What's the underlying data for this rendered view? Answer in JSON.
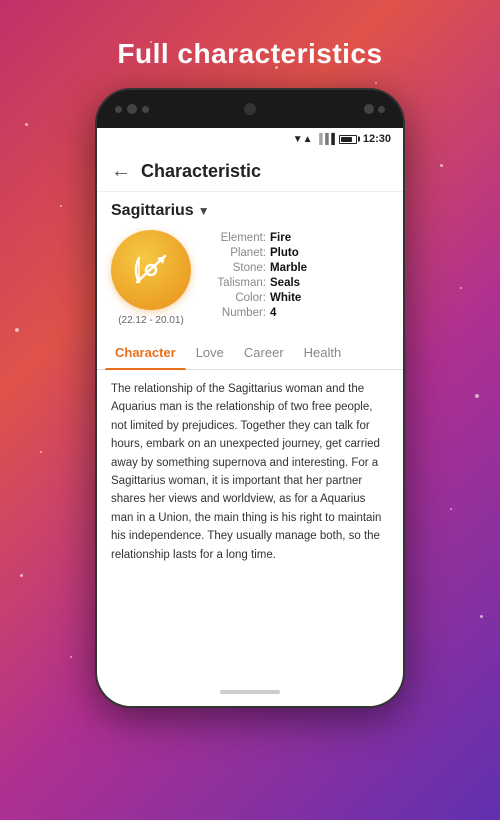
{
  "page": {
    "title": "Full characteristics",
    "background": "linear-gradient pink-to-purple"
  },
  "phone": {
    "status_bar": {
      "time": "12:30"
    },
    "header": {
      "back_label": "←",
      "title": "Characteristic"
    },
    "sign": {
      "name": "Sagittarius",
      "date_range": "(22.12 - 20.01)",
      "properties": [
        {
          "label": "Element:",
          "value": "Fire"
        },
        {
          "label": "Planet:",
          "value": "Pluto"
        },
        {
          "label": "Stone:",
          "value": "Marble"
        },
        {
          "label": "Talisman:",
          "value": "Seals"
        },
        {
          "label": "Color:",
          "value": "White"
        },
        {
          "label": "Number:",
          "value": "4"
        }
      ]
    },
    "tabs": [
      {
        "id": "character",
        "label": "Character",
        "active": true
      },
      {
        "id": "love",
        "label": "Love",
        "active": false
      },
      {
        "id": "career",
        "label": "Career",
        "active": false
      },
      {
        "id": "health",
        "label": "Health",
        "active": false
      }
    ],
    "description": "The relationship of the Sagittarius woman and the Aquarius man is the relationship of two free people, not limited by prejudices. Together they can talk for hours, embark on an unexpected journey, get carried away by something supernova and interesting. For a Sagittarius woman, it is important that her partner shares her views and worldview, as for a Aquarius man in a Union, the main thing is his right to maintain his independence. They usually manage both, so the relationship lasts for a long time."
  }
}
